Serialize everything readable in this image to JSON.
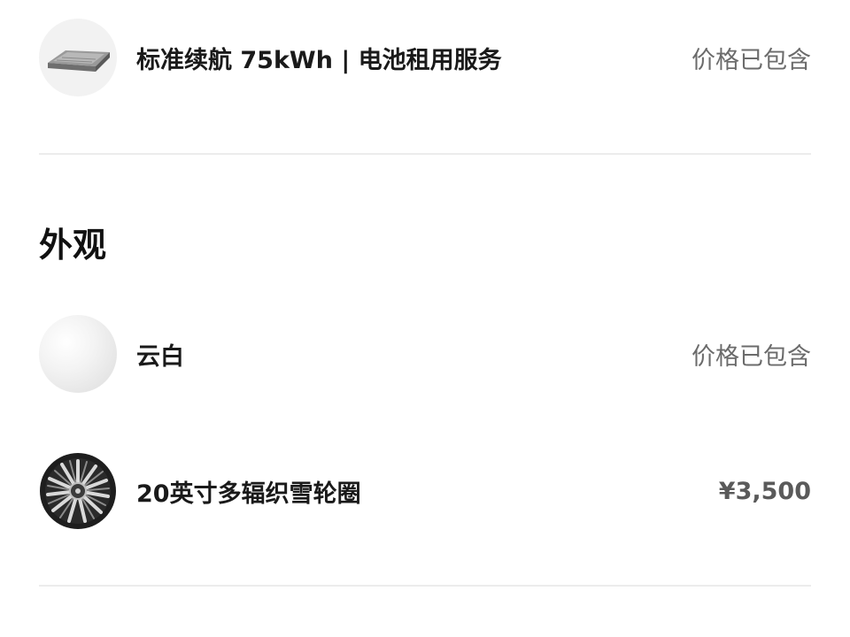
{
  "battery": {
    "icon": "battery-pack-icon",
    "label": "标准续航 75kWh | 电池租用服务",
    "price": "价格已包含"
  },
  "exterior": {
    "title": "外观",
    "color": {
      "icon": "paint-swatch-icon",
      "label": "云白",
      "price": "价格已包含"
    },
    "wheel": {
      "icon": "wheel-rim-icon",
      "label": "20英寸多辐织雪轮圈",
      "price": "¥3,500"
    }
  }
}
